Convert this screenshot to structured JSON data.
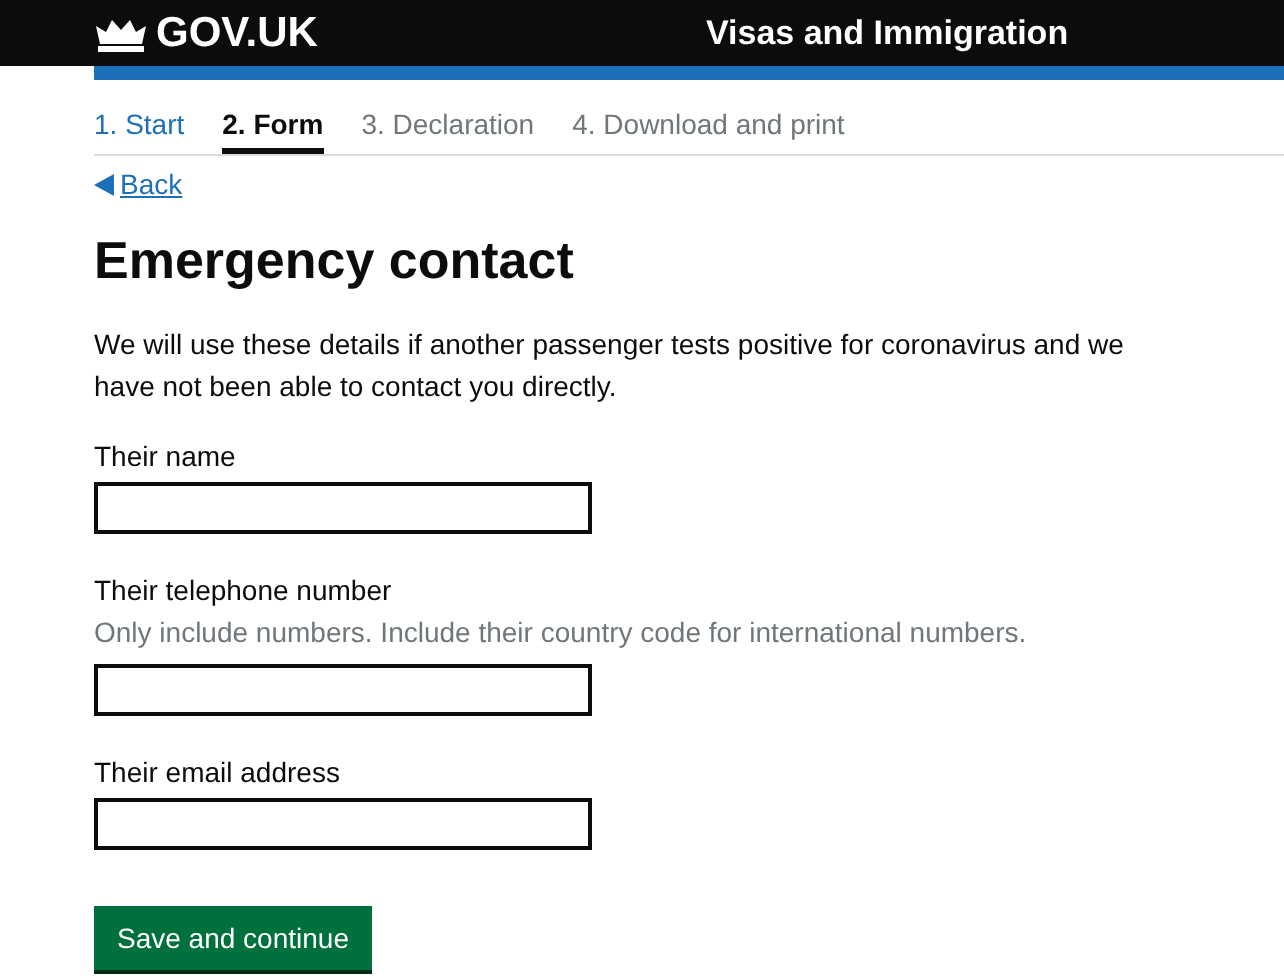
{
  "header": {
    "logo": "GOV.UK",
    "service": "Visas and Immigration"
  },
  "steps": [
    {
      "label": "1. Start",
      "selected": false,
      "completed": true
    },
    {
      "label": "2. Form",
      "selected": true,
      "completed": false
    },
    {
      "label": "3. Declaration",
      "selected": false,
      "completed": false
    },
    {
      "label": "4. Download and print",
      "selected": false,
      "completed": false
    }
  ],
  "back_link": "Back",
  "heading": "Emergency contact",
  "intro": "We will use these details if another passenger tests positive for coronavirus and we have not been able to contact you directly.",
  "fields": [
    {
      "label": "Their name"
    },
    {
      "label": "Their telephone number",
      "hint": "Only include numbers. Include their country code for international numbers."
    },
    {
      "label": "Their email address"
    }
  ],
  "submit": "Save and continue"
}
